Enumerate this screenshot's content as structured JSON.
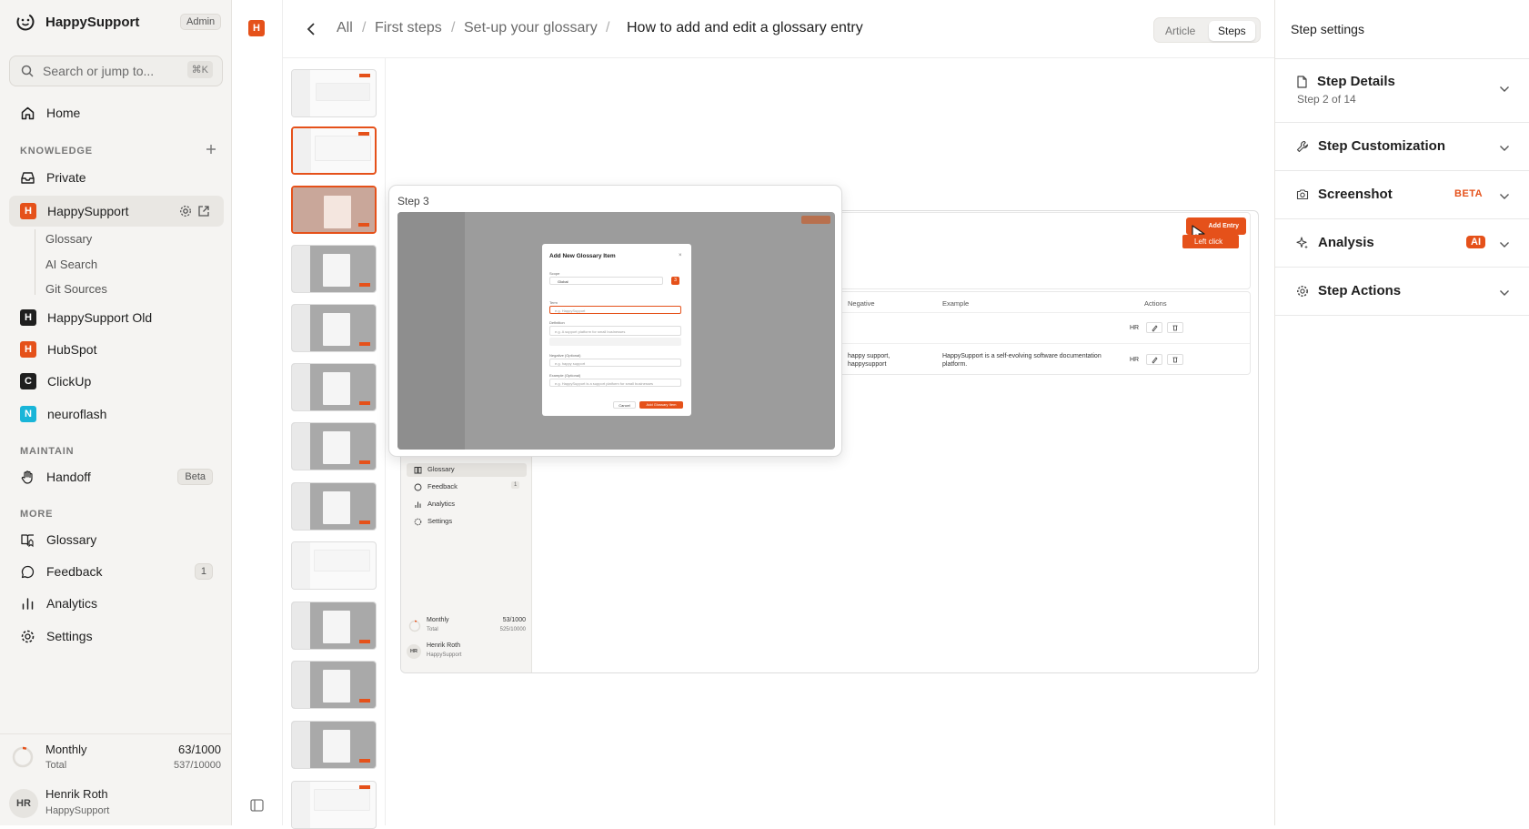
{
  "sidebar": {
    "brand": "HappySupport",
    "role_badge": "Admin",
    "search": {
      "placeholder": "Search or jump to...",
      "shortcut": "⌘K"
    },
    "home": "Home",
    "knowledge_section": "KNOWLEDGE",
    "private": "Private",
    "workspaces": [
      {
        "letter": "H",
        "label": "HappySupport",
        "color": "#e5511a"
      },
      {
        "letter": "H",
        "label": "HappySupport Old",
        "color": "#1f1f1f"
      },
      {
        "letter": "H",
        "label": "HubSpot",
        "color": "#e5511a"
      },
      {
        "letter": "C",
        "label": "ClickUp",
        "color": "#1f1f1f"
      },
      {
        "letter": "N",
        "label": "neuroflash",
        "color": "#19b5d8"
      }
    ],
    "sub_items": [
      "Glossary",
      "AI Search",
      "Git Sources"
    ],
    "maintain_section": "MAINTAIN",
    "handoff": "Handoff",
    "handoff_badge": "Beta",
    "more_section": "MORE",
    "glossary": "Glossary",
    "feedback": "Feedback",
    "feedback_count": "1",
    "analytics": "Analytics",
    "settings": "Settings",
    "usage": {
      "period": "Monthly",
      "period_value": "63/1000",
      "total_label": "Total",
      "total_value": "537/10000"
    },
    "user": {
      "initials": "HR",
      "name": "Henrik Roth",
      "org": "HappySupport"
    }
  },
  "rail": {
    "workspace_letter": "H"
  },
  "header": {
    "breadcrumbs": [
      "All",
      "First steps",
      "Set-up your glossary"
    ],
    "current": "How to add and edit a glossary entry",
    "view_toggle": {
      "article": "Article",
      "steps": "Steps",
      "active": "Steps"
    }
  },
  "thumbnails": {
    "count": 13,
    "selected_index": 1
  },
  "step_preview": {
    "label": "Step 3",
    "modal_title": "Add New Glossary Item",
    "modal_fields": [
      "Scope",
      "Term",
      "Definition",
      "Negative (Optional)",
      "Example (Optional)"
    ],
    "scope_value": "Global",
    "term_placeholder": "e.g. HappySupport",
    "definition_placeholder": "e.g. A support platform for small businesses",
    "negative_placeholder": "e.g. happy support",
    "example_placeholder": "e.g. HappySupport is a support platform for small businesses",
    "cancel": "Cancel",
    "submit": "Add Glossary Item",
    "step_marker": "3"
  },
  "screenshot_content": {
    "add_entry": "Add Entry",
    "left_click": "Left click",
    "columns": [
      "Negative",
      "Example",
      "Actions"
    ],
    "rows": [
      {
        "negative": "",
        "example": "",
        "initials": "HR"
      },
      {
        "negative": "happy support, happysupport",
        "example": "HappySupport is a self-evolving software documentation platform.",
        "initials": "HR"
      }
    ],
    "nav": [
      "Glossary",
      "Feedback",
      "Analytics",
      "Settings"
    ],
    "feedback_count": "1",
    "usage": {
      "period": "Monthly",
      "period_value": "53/1000",
      "total_label": "Total",
      "total_value": "525/10000"
    },
    "user": {
      "initials": "HR",
      "name": "Henrik Roth",
      "org": "HappySupport"
    }
  },
  "right_panel": {
    "title": "Step settings",
    "step_details": {
      "label": "Step Details",
      "sub": "Step 2 of 14"
    },
    "customization": "Step Customization",
    "screenshot": {
      "label": "Screenshot",
      "badge": "BETA"
    },
    "analysis": {
      "label": "Analysis",
      "badge": "AI"
    },
    "actions": "Step Actions"
  },
  "colors": {
    "accent": "#e5511a",
    "sidebar_bg": "#f5f4f2"
  }
}
